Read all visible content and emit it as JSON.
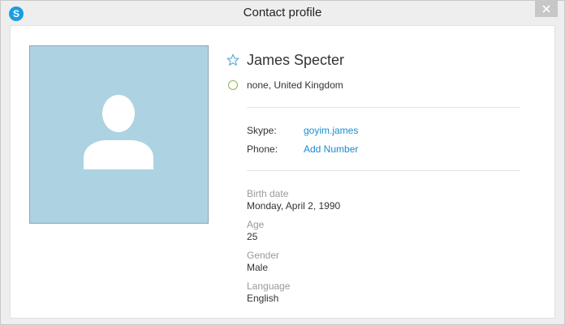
{
  "window": {
    "title": "Contact profile",
    "app_icon_letter": "S"
  },
  "profile": {
    "name": "James Specter",
    "location": "none, United Kingdom",
    "skype_label": "Skype:",
    "skype_value": "goyim.james",
    "phone_label": "Phone:",
    "phone_value": "Add Number",
    "birth_label": "Birth date",
    "birth_value": "Monday, April 2, 1990",
    "age_label": "Age",
    "age_value": "25",
    "gender_label": "Gender",
    "gender_value": "Male",
    "language_label": "Language",
    "language_value": "English"
  },
  "icons": {
    "app": "skype-icon",
    "close": "close-icon",
    "star": "star-icon",
    "status": "status-circle-icon",
    "avatar": "default-avatar-icon"
  },
  "colors": {
    "accent": "#1a8ccc",
    "avatar_bg": "#add3e2",
    "status": "#8bb84c"
  }
}
